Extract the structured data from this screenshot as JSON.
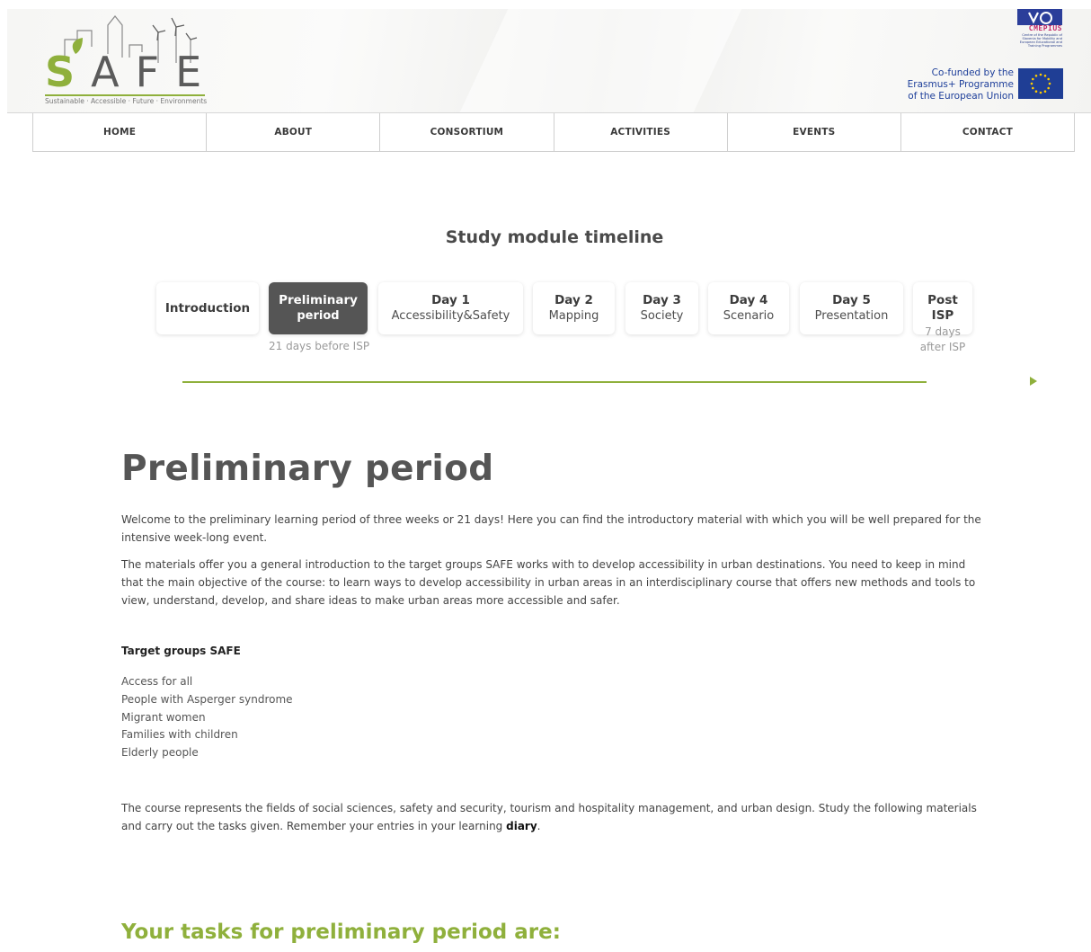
{
  "header": {
    "logo": {
      "word_first": "S",
      "word_rest": "AFE",
      "tagline": "Sustainable · Accessible · Future · Environments"
    },
    "partner": {
      "name": "CMEPIUS",
      "description": "Centre of the Republic of Slovenia for Mobility and European Educational and Training Programmes"
    },
    "cofund": {
      "line1": "Co-funded by the",
      "line2": "Erasmus+ Programme",
      "line3": "of the European Union"
    }
  },
  "nav": {
    "items": [
      {
        "label": "HOME"
      },
      {
        "label": "ABOUT"
      },
      {
        "label": "CONSORTIUM"
      },
      {
        "label": "ACTIVITIES"
      },
      {
        "label": "EVENTS"
      },
      {
        "label": "CONTACT"
      }
    ]
  },
  "timeline": {
    "title": "Study module timeline",
    "items": [
      {
        "line1": "Introduction",
        "line2": ""
      },
      {
        "line1": "Preliminary",
        "line2": "period",
        "sub": "21 days before ISP",
        "active": true
      },
      {
        "line1": "Day 1",
        "line2": "Accessibility&Safety"
      },
      {
        "line1": "Day 2",
        "line2": "Mapping"
      },
      {
        "line1": "Day 3",
        "line2": "Society"
      },
      {
        "line1": "Day 4",
        "line2": "Scenario"
      },
      {
        "line1": "Day 5",
        "line2": "Presentation"
      },
      {
        "line1": "Post",
        "line2": "ISP",
        "sub_line1": "7 days",
        "sub_line2": "after ISP"
      }
    ]
  },
  "content": {
    "title": "Preliminary period",
    "para1": "Welcome to the preliminary learning period of three weeks or 21 days! Here you can find the introductory material with which you will be well prepared for the intensive week-long event.",
    "para2": "The materials offer you a general introduction to the target groups SAFE works with to develop accessibility in urban destinations. You need to keep in mind that the main objective of the course: to learn ways to develop accessibility in urban areas in an interdisciplinary course that offers new methods and tools to view, understand, develop, and share ideas to make urban areas more accessible and safer.",
    "groups_heading": "Target groups SAFE",
    "groups": [
      "Access for all",
      "People with Asperger syndrome",
      "Migrant women",
      "Families with children",
      "Elderly people"
    ],
    "para3_text": "The course represents the fields of social sciences, safety and security, tourism and hospitality management, and urban design. Study the following materials and carry out the tasks given. Remember your entries in your learning ",
    "para3_link": "diary",
    "para3_end": ".",
    "tasks_heading": "Your tasks for preliminary period are:"
  },
  "colors": {
    "accent_green": "#8fb03c",
    "active_card": "#555555",
    "eu_blue": "#1f3e95"
  }
}
